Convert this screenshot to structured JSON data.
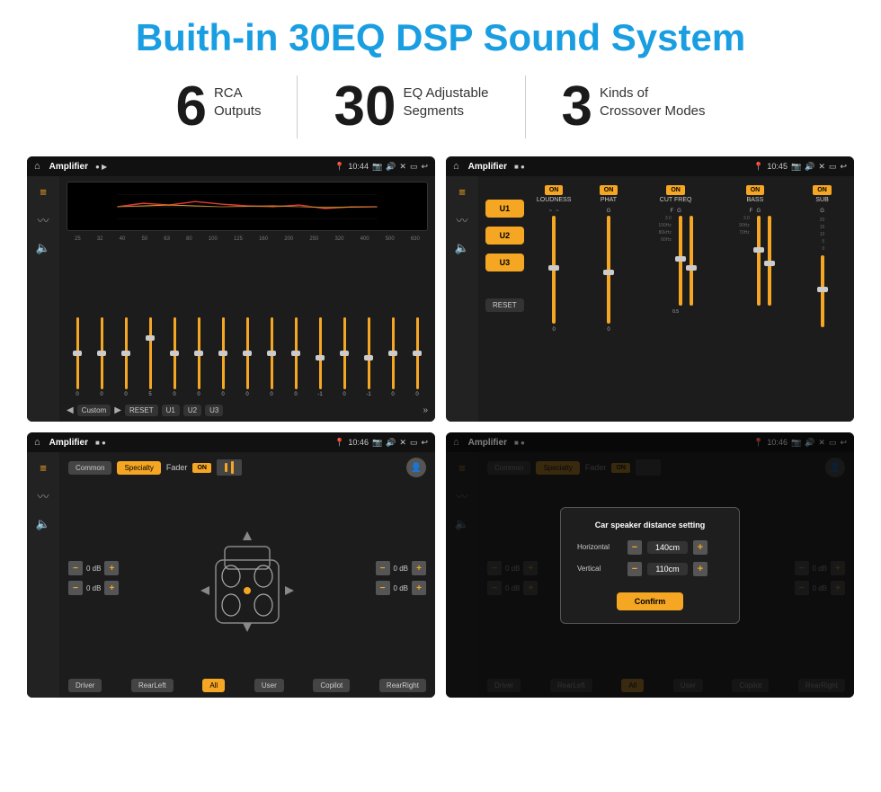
{
  "title": "Buith-in 30EQ DSP Sound System",
  "stats": [
    {
      "number": "6",
      "label": "RCA\nOutputs"
    },
    {
      "number": "30",
      "label": "EQ Adjustable\nSegments"
    },
    {
      "number": "3",
      "label": "Kinds of\nCrossover Modes"
    }
  ],
  "screens": [
    {
      "id": "eq-screen",
      "statusbar": {
        "app": "Amplifier",
        "time": "10:44",
        "icons": "🏠"
      },
      "type": "eq"
    },
    {
      "id": "crossover-screen",
      "statusbar": {
        "app": "Amplifier",
        "time": "10:45"
      },
      "type": "crossover"
    },
    {
      "id": "fader-screen",
      "statusbar": {
        "app": "Amplifier",
        "time": "10:46"
      },
      "type": "fader"
    },
    {
      "id": "distance-screen",
      "statusbar": {
        "app": "Amplifier",
        "time": "10:46"
      },
      "type": "distance",
      "dialog": {
        "title": "Car speaker distance setting",
        "horizontal_label": "Horizontal",
        "horizontal_value": "140cm",
        "vertical_label": "Vertical",
        "vertical_value": "110cm",
        "confirm": "Confirm"
      }
    }
  ],
  "eq": {
    "frequencies": [
      "25",
      "32",
      "40",
      "50",
      "63",
      "80",
      "100",
      "125",
      "160",
      "200",
      "250",
      "320",
      "400",
      "500",
      "630"
    ],
    "values": [
      "0",
      "0",
      "0",
      "5",
      "0",
      "0",
      "0",
      "0",
      "0",
      "0",
      "-1",
      "0",
      "-1"
    ],
    "preset": "Custom",
    "buttons": [
      "RESET",
      "U1",
      "U2",
      "U3"
    ]
  },
  "crossover": {
    "u_buttons": [
      "U1",
      "U2",
      "U3"
    ],
    "channels": [
      {
        "label": "LOUDNESS",
        "on": true
      },
      {
        "label": "PHAT",
        "on": true
      },
      {
        "label": "CUT FREQ",
        "on": true
      },
      {
        "label": "BASS",
        "on": true
      },
      {
        "label": "SUB",
        "on": true
      }
    ],
    "reset": "RESET"
  },
  "fader": {
    "tabs": [
      "Common",
      "Specialty"
    ],
    "active_tab": "Specialty",
    "fader_label": "Fader",
    "on_label": "ON",
    "db_values": [
      "0 dB",
      "0 dB",
      "0 dB",
      "0 dB"
    ],
    "bottom_buttons": [
      "Driver",
      "RearLeft",
      "All",
      "User",
      "Copilot",
      "RearRight"
    ]
  },
  "distance_dialog": {
    "title": "Car speaker distance setting",
    "horizontal": "Horizontal",
    "horizontal_value": "140cm",
    "vertical": "Vertical",
    "vertical_value": "110cm",
    "confirm": "Confirm"
  }
}
